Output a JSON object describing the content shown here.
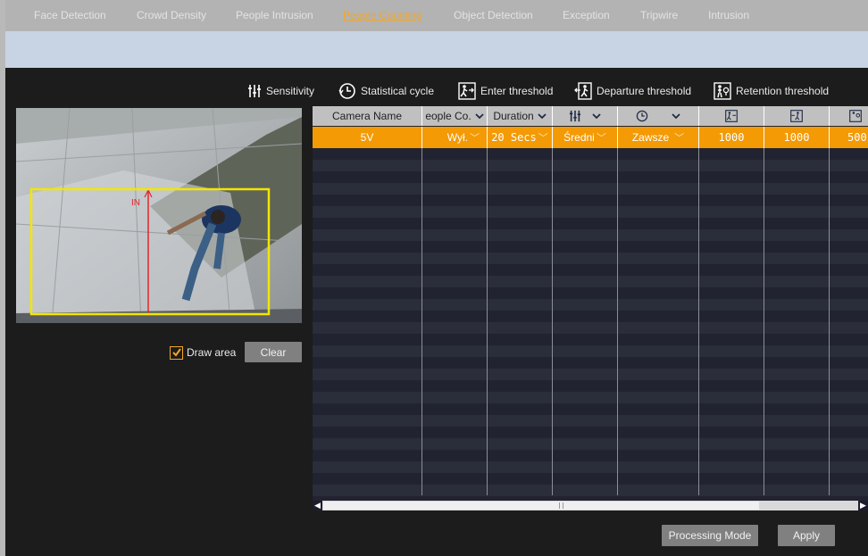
{
  "tabs": [
    {
      "label": "Face Detection",
      "active": false
    },
    {
      "label": "Crowd Density",
      "active": false
    },
    {
      "label": "People Intrusion",
      "active": false
    },
    {
      "label": "People Counting",
      "active": true
    },
    {
      "label": "Object Detection",
      "active": false
    },
    {
      "label": "Exception",
      "active": false
    },
    {
      "label": "Tripwire",
      "active": false
    },
    {
      "label": "Intrusion",
      "active": false
    }
  ],
  "legend": {
    "sensitivity": "Sensitivity",
    "statistical_cycle": "Statistical cycle",
    "enter_threshold": "Enter threshold",
    "departure_threshold": "Departure threshold",
    "retention_threshold": "Retention threshold"
  },
  "preview": {
    "direction_label": "IN"
  },
  "draw_area": {
    "label": "Draw area",
    "checked": true
  },
  "buttons": {
    "clear": "Clear",
    "processing_mode": "Processing Mode",
    "apply": "Apply"
  },
  "table": {
    "headers": {
      "camera_name": "Camera Name",
      "people_counting": "eople Co.",
      "duration": "Duration"
    },
    "row": {
      "camera_name": "5V",
      "people_counting": "Wył.",
      "duration": "20 Secs",
      "sensitivity": "Średni",
      "statistical_cycle": "Zawsze",
      "enter_threshold": "1000",
      "departure_threshold": "1000",
      "retention_threshold": "500"
    }
  },
  "colors": {
    "accent": "#f39a05",
    "active_tab": "#f5a623",
    "draw_region": "#f2e600"
  }
}
